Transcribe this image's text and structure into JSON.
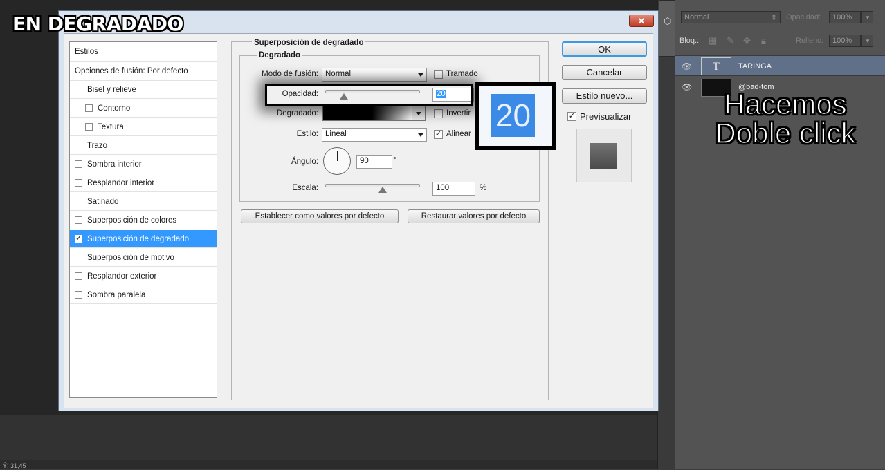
{
  "overlay": {
    "title": "EN DEGRADADO",
    "note": "Hacemos Doble click",
    "zoom_value": "20"
  },
  "dialog": {
    "close_symbol": "✕",
    "styles": [
      {
        "label": "Estilos",
        "checkbox": false,
        "checked": false,
        "indent": false
      },
      {
        "label": "Opciones de fusión: Por defecto",
        "checkbox": false,
        "checked": false,
        "indent": false
      },
      {
        "label": "Bisel y relieve",
        "checkbox": true,
        "checked": false,
        "indent": false
      },
      {
        "label": "Contorno",
        "checkbox": true,
        "checked": false,
        "indent": true
      },
      {
        "label": "Textura",
        "checkbox": true,
        "checked": false,
        "indent": true
      },
      {
        "label": "Trazo",
        "checkbox": true,
        "checked": false,
        "indent": false
      },
      {
        "label": "Sombra interior",
        "checkbox": true,
        "checked": false,
        "indent": false
      },
      {
        "label": "Resplandor interior",
        "checkbox": true,
        "checked": false,
        "indent": false
      },
      {
        "label": "Satinado",
        "checkbox": true,
        "checked": false,
        "indent": false
      },
      {
        "label": "Superposición de colores",
        "checkbox": true,
        "checked": false,
        "indent": false
      },
      {
        "label": "Superposición de degradado",
        "checkbox": true,
        "checked": true,
        "indent": false,
        "selected": true
      },
      {
        "label": "Superposición de motivo",
        "checkbox": true,
        "checked": false,
        "indent": false
      },
      {
        "label": "Resplandor exterior",
        "checkbox": true,
        "checked": false,
        "indent": false
      },
      {
        "label": "Sombra paralela",
        "checkbox": true,
        "checked": false,
        "indent": false
      }
    ],
    "group_title": "Superposición de degradado",
    "sub_title": "Degradado",
    "blend_label": "Modo de fusión:",
    "blend_value": "Normal",
    "tramado_label": "Tramado",
    "opacity_label": "Opacidad:",
    "opacity_value": "20",
    "gradient_label": "Degradado:",
    "invertir_label": "Invertir",
    "style_label": "Estilo:",
    "style_value": "Lineal",
    "alinear_label": "Alinear",
    "angle_label": "Ángulo:",
    "angle_value": "90",
    "angle_unit": "°",
    "scale_label": "Escala:",
    "scale_value": "100",
    "scale_unit": "%",
    "btn_default": "Establecer como valores por defecto",
    "btn_restore": "Restaurar valores por defecto",
    "btn_ok": "OK",
    "btn_cancel": "Cancelar",
    "btn_new_style": "Estilo nuevo...",
    "preview_label": "Previsualizar"
  },
  "layers_panel": {
    "blend_mode": "Normal",
    "opacity_label": "Opacidad:",
    "opacity_value": "100%",
    "lock_label": "Bloq.:",
    "fill_label": "Relleno:",
    "fill_value": "100%",
    "layers": [
      {
        "name": "TARINGA",
        "type": "text",
        "thumb": "T"
      },
      {
        "name": "@bad-tom",
        "type": "raster"
      }
    ]
  },
  "status_bar": {
    "text": "Ý: 31,45"
  }
}
